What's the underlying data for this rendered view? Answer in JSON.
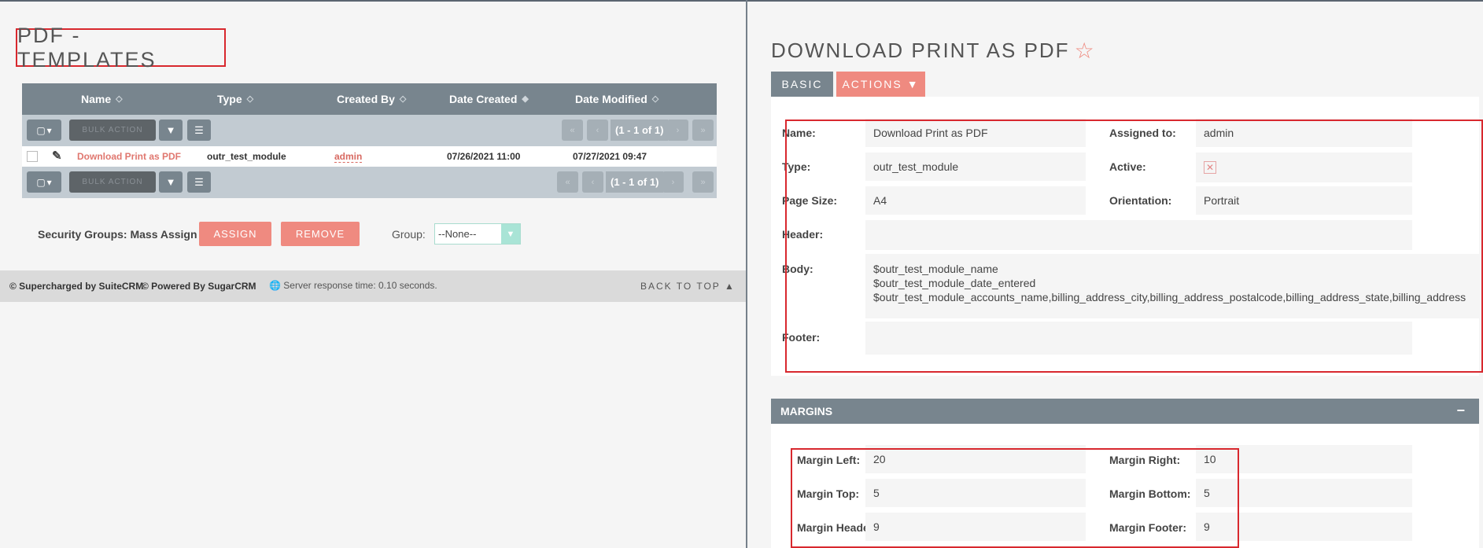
{
  "left": {
    "page_title": "PDF - TEMPLATES",
    "columns": [
      {
        "label": "Name"
      },
      {
        "label": "Type"
      },
      {
        "label": "Created By"
      },
      {
        "label": "Date Created"
      },
      {
        "label": "Date Modified"
      }
    ],
    "toolbar": {
      "bulk_action_label": "BULK ACTION",
      "page_count": "(1 - 1 of 1)"
    },
    "rows": [
      {
        "name": "Download Print as PDF",
        "type": "outr_test_module",
        "created_by": "admin",
        "date_created": "07/26/2021 11:00",
        "date_modified": "07/27/2021 09:47"
      }
    ],
    "security_groups": {
      "label": "Security Groups: Mass Assign",
      "assign_label": "ASSIGN",
      "remove_label": "REMOVE",
      "group_label": "Group:",
      "group_value": "--None--"
    },
    "footer": {
      "supercharged": "© Supercharged by SuiteCRM",
      "powered": "© Powered By SugarCRM",
      "response": "Server response time: 0.10 seconds.",
      "back_to_top": "BACK TO TOP"
    }
  },
  "right": {
    "title": "DOWNLOAD PRINT AS PDF",
    "tab_basic": "BASIC",
    "tab_actions": "ACTIONS",
    "fields": {
      "name_label": "Name:",
      "name_value": "Download Print as PDF",
      "assigned_label": "Assigned to:",
      "assigned_value": "admin",
      "type_label": "Type:",
      "type_value": "outr_test_module",
      "active_label": "Active:",
      "page_size_label": "Page Size:",
      "page_size_value": "A4",
      "orientation_label": "Orientation:",
      "orientation_value": "Portrait",
      "header_label": "Header:",
      "body_label": "Body:",
      "body_line1": "$outr_test_module_name",
      "body_line2": "$outr_test_module_date_entered",
      "body_line3": "$outr_test_module_accounts_name,billing_address_city,billing_address_postalcode,billing_address_state,billing_address",
      "footer_label": "Footer:"
    },
    "margins": {
      "title": "MARGINS",
      "left_label": "Margin Left:",
      "left_value": "20",
      "right_label": "Margin Right:",
      "right_value": "10",
      "top_label": "Margin Top:",
      "top_value": "5",
      "bottom_label": "Margin Bottom:",
      "bottom_value": "5",
      "header_label": "Margin Header:",
      "header_value": "9",
      "footer_label": "Margin Footer:",
      "footer_value": "9"
    }
  },
  "colors": {
    "accent_red": "#ef8a80",
    "header_gray": "#78858e",
    "highlight_red": "#d8282e"
  }
}
